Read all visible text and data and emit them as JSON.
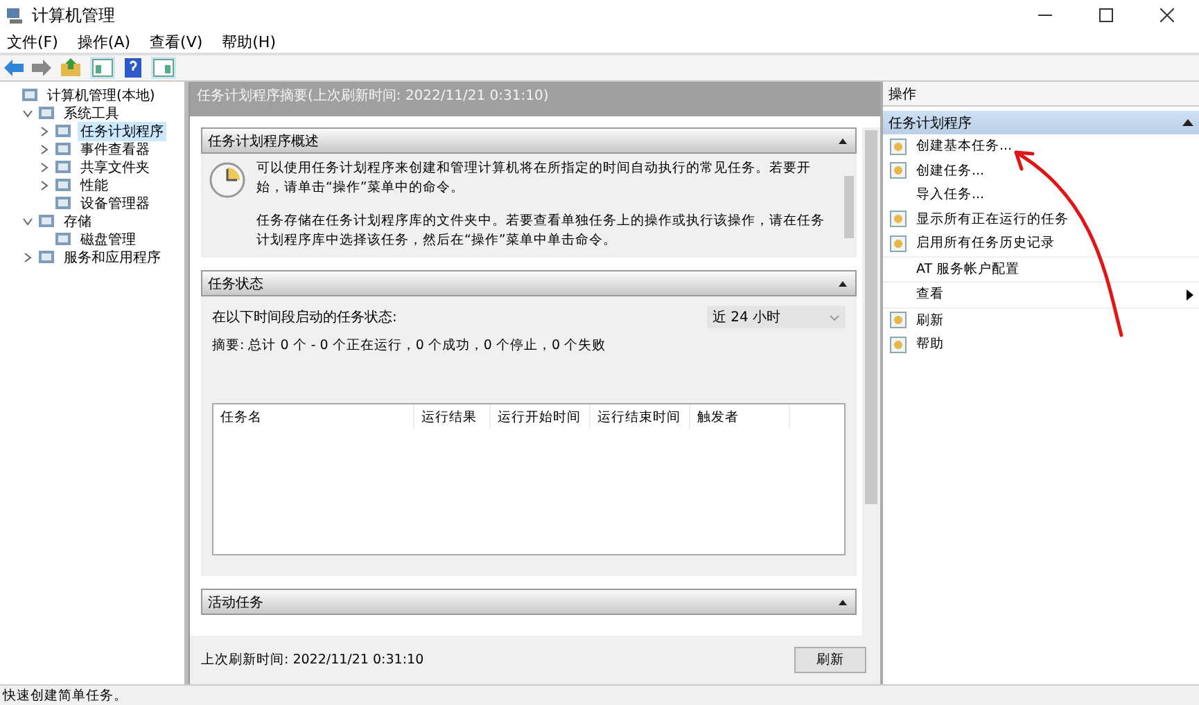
{
  "window": {
    "title": "计算机管理"
  },
  "menu": [
    "文件(F)",
    "操作(A)",
    "查看(V)",
    "帮助(H)"
  ],
  "tree": [
    {
      "label": "计算机管理(本地)",
      "selected": false,
      "children": [
        {
          "label": "系统工具",
          "selected": false,
          "expanded": true,
          "children": [
            {
              "label": "任务计划程序",
              "selected": true,
              "expanded": false
            },
            {
              "label": "事件查看器",
              "selected": false,
              "expanded": false
            },
            {
              "label": "共享文件夹",
              "selected": false,
              "expanded": false
            },
            {
              "label": "性能",
              "selected": false,
              "expanded": false
            },
            {
              "label": "设备管理器",
              "selected": false
            }
          ]
        },
        {
          "label": "存储",
          "selected": false,
          "expanded": true,
          "children": [
            {
              "label": "磁盘管理",
              "selected": false
            }
          ]
        },
        {
          "label": "服务和应用程序",
          "selected": false,
          "expanded": false
        }
      ]
    }
  ],
  "summary": {
    "header": "任务计划程序摘要(上次刷新时间: 2022/11/21 0:31:10)",
    "overview": {
      "title": "任务计划程序概述",
      "paragraphs": [
        "可以使用任务计划程序来创建和管理计算机将在所指定的时间自动执行的常见任务。若要开始，请单击“操作”菜单中的命令。",
        "任务存储在任务计划程序库的文件夹中。若要查看单独任务上的操作或执行该操作，请在任务计划程序库中选择该任务，然后在“操作”菜单中单击命令。"
      ]
    },
    "status": {
      "title": "任务状态",
      "period_label": "在以下时间段启动的任务状态:",
      "period": "近 24 小时",
      "summary": "摘要: 总计 0 个 - 0 个正在运行，0 个成功，0 个停止，0 个失败",
      "columns": [
        "任务名",
        "运行结果",
        "运行开始时间",
        "运行结束时间",
        "触发者"
      ]
    },
    "active": {
      "title": "活动任务"
    },
    "last_refresh": "上次刷新时间: 2022/11/21 0:31:10",
    "refresh_button": "刷新"
  },
  "actions": {
    "title": "操作",
    "section": "任务计划程序",
    "groups": [
      [
        {
          "label": "创建基本任务...",
          "kind": "icon"
        },
        {
          "label": "创建任务...",
          "kind": "icon"
        },
        {
          "label": "导入任务...",
          "kind": "plain"
        },
        {
          "label": "显示所有正在运行的任务",
          "kind": "icon"
        },
        {
          "label": "启用所有任务历史记录",
          "kind": "icon"
        }
      ],
      [
        {
          "label": "AT 服务帐户配置",
          "kind": "plain"
        }
      ],
      [
        {
          "label": "查看",
          "kind": "submenu"
        }
      ],
      [
        {
          "label": "刷新",
          "kind": "icon"
        },
        {
          "label": "帮助",
          "kind": "icon"
        }
      ]
    ]
  },
  "status_bar": "快速创建简单任务。"
}
